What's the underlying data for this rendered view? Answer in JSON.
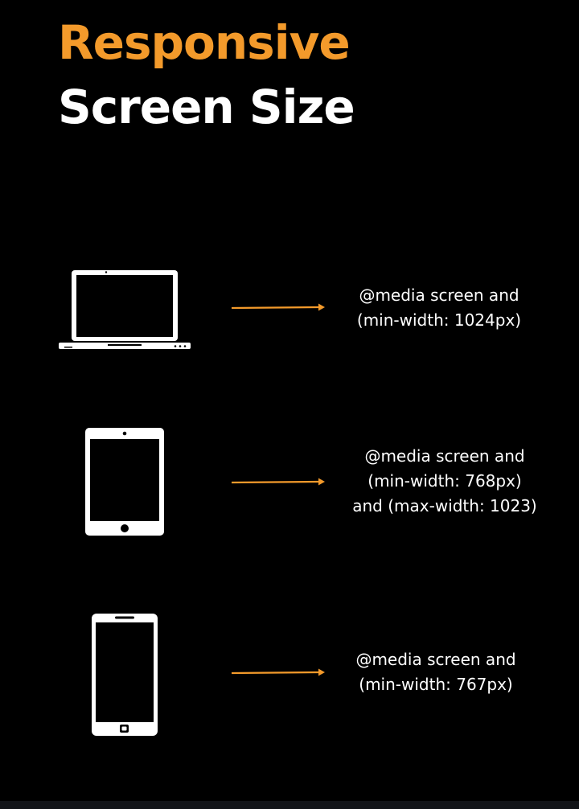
{
  "title": {
    "line1": "Responsive",
    "line2": "Screen Size"
  },
  "colors": {
    "background": "#000000",
    "accent": "#F39A2B",
    "text": "#FFFFFF"
  },
  "rules": [
    {
      "device_icon": "laptop-icon",
      "lines": [
        "@media screen and",
        "(min-width: 1024px)"
      ]
    },
    {
      "device_icon": "tablet-icon",
      "lines": [
        "@media screen and",
        "(min-width: 768px)",
        "and (max-width: 1023)"
      ]
    },
    {
      "device_icon": "phone-icon",
      "lines": [
        "@media screen and",
        "(min-width: 767px)"
      ]
    }
  ]
}
